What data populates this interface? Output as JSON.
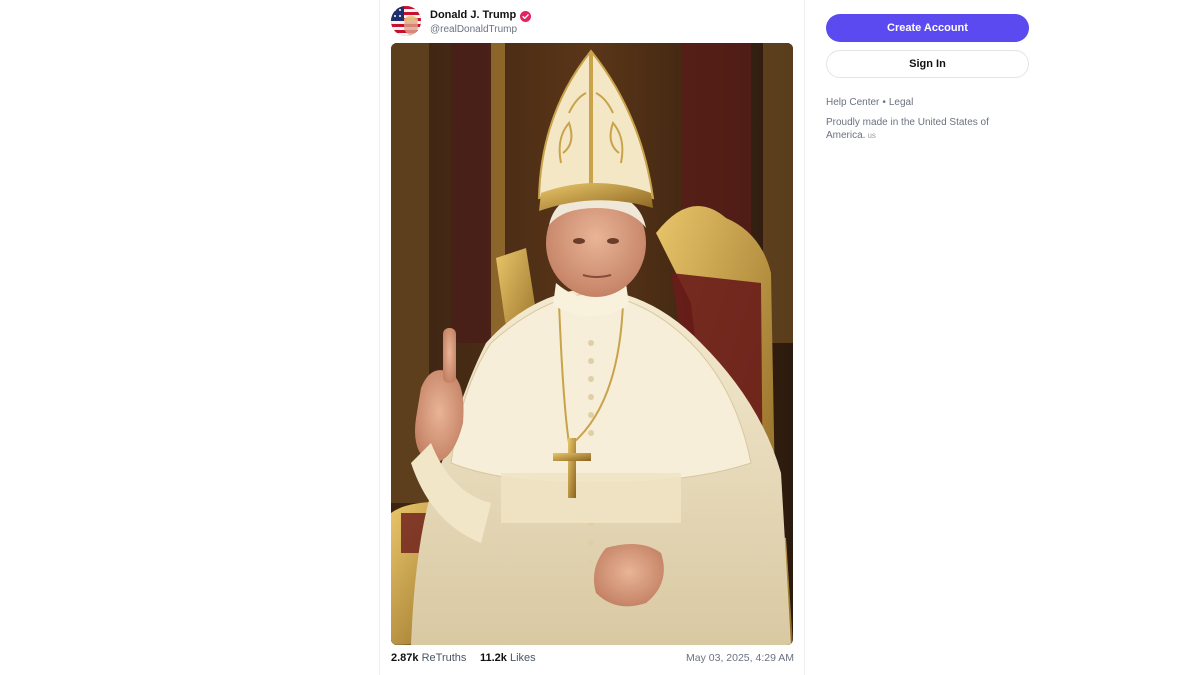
{
  "post": {
    "author_name": "Donald J. Trump",
    "author_handle": "@realDonaldTrump",
    "verified_icon": "verified-badge-icon",
    "image_alt": "Figure seated on a gilded throne in white papal vestments and mitre, raising index finger",
    "stats": {
      "retruths_count": "2.87k",
      "retruths_label": "ReTruths",
      "likes_count": "11.2k",
      "likes_label": "Likes"
    },
    "timestamp": "May 03, 2025, 4:29 AM"
  },
  "sidebar": {
    "create_account_label": "Create Account",
    "sign_in_label": "Sign In",
    "help_center_label": "Help Center",
    "separator": "•",
    "legal_label": "Legal",
    "made_in_text": "Proudly made in the United States of America.",
    "country_code": "us"
  },
  "colors": {
    "accent": "#5b4af0",
    "verified": "#e0245e"
  }
}
